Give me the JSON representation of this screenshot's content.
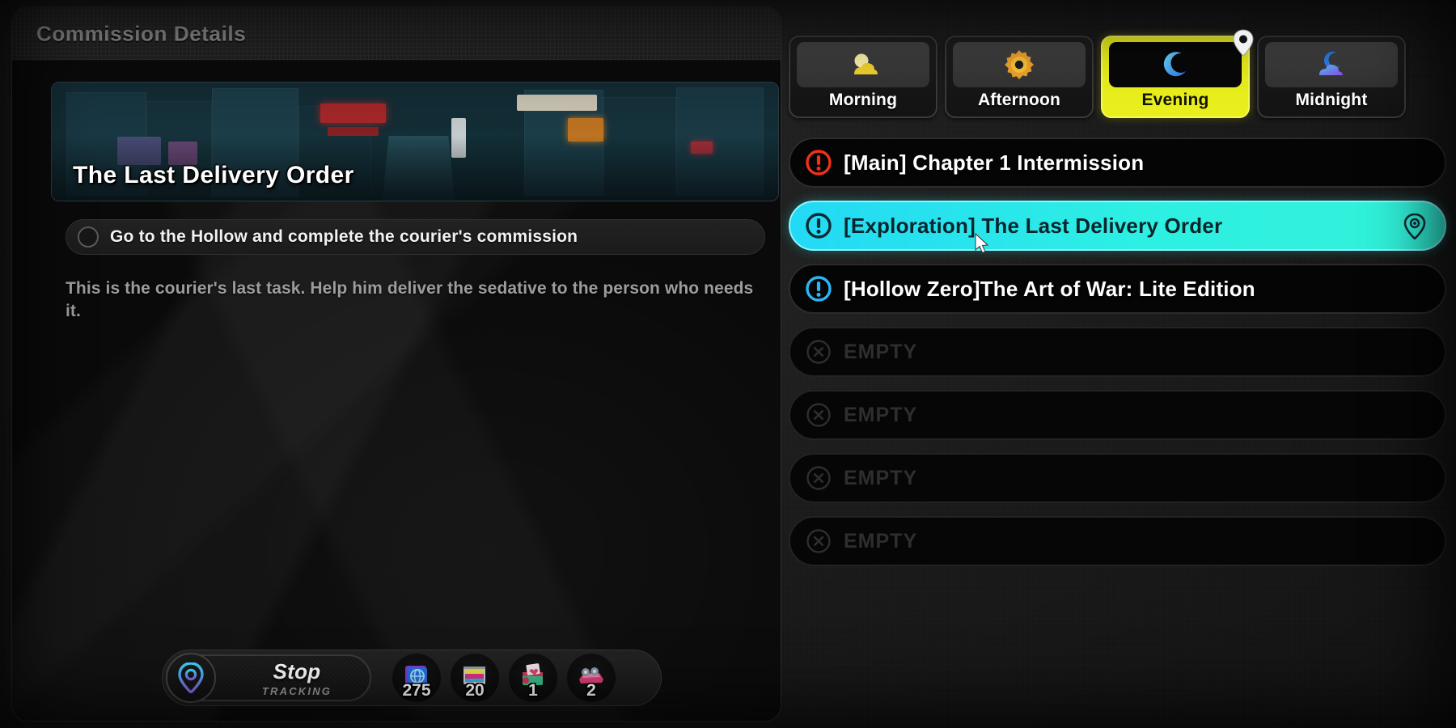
{
  "left_panel": {
    "header_title": "Commission Details",
    "hero_title": "The Last Delivery Order",
    "objective": "Go to the Hollow and complete the courier's commission",
    "description": "This is the courier's last task. Help him deliver the sedative to the person who needs it.",
    "tracking": {
      "main_label": "Stop",
      "sub_label": "TRACKING",
      "pin_icon": "location-pin-icon"
    },
    "currencies": [
      {
        "icon": "denny-card-icon",
        "value": "275",
        "color": "#3fa9f5"
      },
      {
        "icon": "film-strip-icon",
        "value": "20",
        "color": "#f2c53d"
      },
      {
        "icon": "gift-box-icon",
        "value": "1",
        "color": "#3fbf8f"
      },
      {
        "icon": "toy-car-icon",
        "value": "2",
        "color": "#e0417a"
      }
    ]
  },
  "right_panel": {
    "time_tabs": [
      {
        "label": "Morning",
        "icon": "sun-cloud-icon",
        "active": false,
        "has_pin": false
      },
      {
        "label": "Afternoon",
        "icon": "sun-icon",
        "active": false,
        "has_pin": false
      },
      {
        "label": "Evening",
        "icon": "crescent-moon-icon",
        "active": true,
        "has_pin": true
      },
      {
        "label": "Midnight",
        "icon": "moon-cloud-icon",
        "active": false,
        "has_pin": false
      }
    ],
    "quests": [
      {
        "label": "[Main] Chapter 1 Intermission",
        "icon": "alert-exclamation-icon",
        "icon_color": "#f23018",
        "state": "normal",
        "has_target": false
      },
      {
        "label": "[Exploration] The Last Delivery Order",
        "icon": "alert-exclamation-icon",
        "icon_color": "#0b2b33",
        "state": "selected",
        "has_target": true
      },
      {
        "label": "[Hollow Zero]The Art of War: Lite Edition",
        "icon": "alert-exclamation-icon",
        "icon_color": "#2bb6 f2",
        "state": "normal",
        "has_target": false
      },
      {
        "label": "EMPTY",
        "icon": "close-x-icon",
        "icon_color": "#2e2e2e",
        "state": "empty",
        "has_target": false
      },
      {
        "label": "EMPTY",
        "icon": "close-x-icon",
        "icon_color": "#2e2e2e",
        "state": "empty",
        "has_target": false
      },
      {
        "label": "EMPTY",
        "icon": "close-x-icon",
        "icon_color": "#2e2e2e",
        "state": "empty",
        "has_target": false
      },
      {
        "label": "EMPTY",
        "icon": "close-x-icon",
        "icon_color": "#2e2e2e",
        "state": "empty",
        "has_target": false
      }
    ]
  },
  "cursor": {
    "icon": "mouse-pointer-icon"
  },
  "colors": {
    "accent_yellow": "#e9ef1c",
    "accent_cyan": "#2ee8e0",
    "alert_red": "#f23018",
    "alert_blue": "#2bb6f2",
    "panel_bg": "#0a0a0a"
  }
}
